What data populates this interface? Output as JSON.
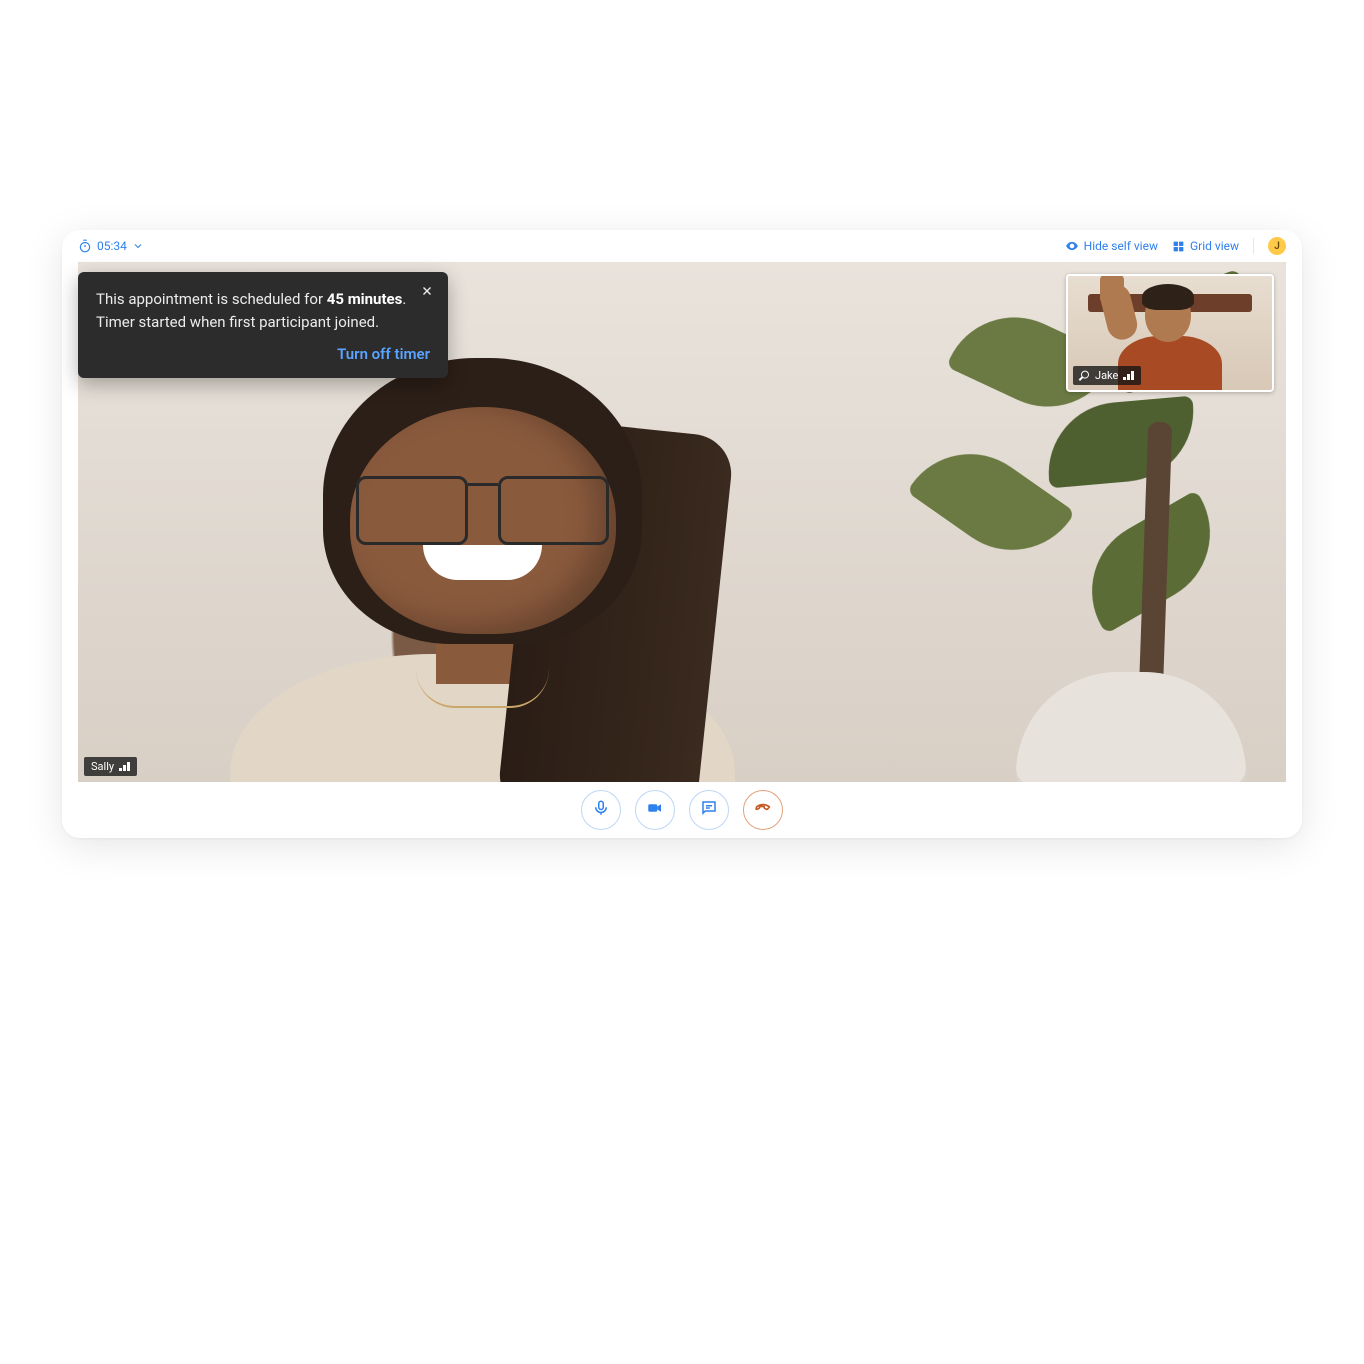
{
  "topbar": {
    "timer": "05:34",
    "hide_self_view": "Hide self view",
    "grid_view": "Grid view",
    "avatar_initial": "J"
  },
  "tooltip": {
    "text_prefix": "This appointment is scheduled for ",
    "duration": "45 minutes",
    "text_suffix": ". Timer started when first participant joined.",
    "action": "Turn off timer"
  },
  "participants": {
    "main": {
      "name": "Sally"
    },
    "pip": {
      "name": "Jake"
    }
  },
  "controls": {
    "mic": "microphone",
    "camera": "camera",
    "chat": "chat",
    "end": "end-call"
  }
}
